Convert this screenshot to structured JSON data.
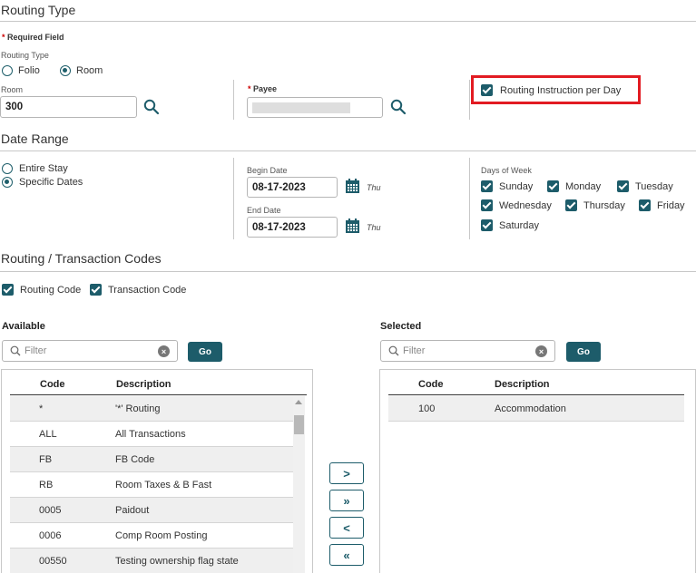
{
  "routing_type": {
    "section_title": "Routing Type",
    "required_note": "Required Field",
    "field_label": "Routing Type",
    "options": [
      {
        "label": "Folio",
        "selected": false
      },
      {
        "label": "Room",
        "selected": true
      }
    ],
    "room_label": "Room",
    "room_value": "300",
    "payee_label": "Payee",
    "payee_value": "",
    "per_day_label": "Routing Instruction per Day",
    "per_day_checked": true
  },
  "date_range": {
    "section_title": "Date Range",
    "options": [
      {
        "label": "Entire Stay",
        "selected": false
      },
      {
        "label": "Specific Dates",
        "selected": true
      }
    ],
    "begin_label": "Begin Date",
    "begin_value": "08-17-2023",
    "begin_day": "Thu",
    "end_label": "End Date",
    "end_value": "08-17-2023",
    "end_day": "Thu",
    "days_label": "Days of Week",
    "days": [
      {
        "label": "Sunday",
        "checked": true
      },
      {
        "label": "Monday",
        "checked": true
      },
      {
        "label": "Tuesday",
        "checked": true
      },
      {
        "label": "Wednesday",
        "checked": true
      },
      {
        "label": "Thursday",
        "checked": true
      },
      {
        "label": "Friday",
        "checked": true
      },
      {
        "label": "Saturday",
        "checked": true
      }
    ]
  },
  "codes": {
    "section_title": "Routing / Transaction Codes",
    "routing_code_label": "Routing Code",
    "transaction_code_label": "Transaction Code",
    "available": {
      "title": "Available",
      "filter_placeholder": "Filter",
      "go_label": "Go",
      "col_code": "Code",
      "col_desc": "Description",
      "rows": [
        {
          "code": "*",
          "desc": "'*' Routing"
        },
        {
          "code": "ALL",
          "desc": "All Transactions"
        },
        {
          "code": "FB",
          "desc": "FB Code"
        },
        {
          "code": "RB",
          "desc": "Room Taxes & B Fast"
        },
        {
          "code": "0005",
          "desc": "Paidout"
        },
        {
          "code": "0006",
          "desc": "Comp Room Posting"
        },
        {
          "code": "00550",
          "desc": "Testing ownership flag state"
        }
      ]
    },
    "selected": {
      "title": "Selected",
      "filter_placeholder": "Filter",
      "go_label": "Go",
      "col_code": "Code",
      "col_desc": "Description",
      "rows": [
        {
          "code": "100",
          "desc": "Accommodation"
        }
      ]
    },
    "move_buttons": [
      ">",
      "»",
      "<",
      "«"
    ]
  },
  "colors": {
    "accent": "#1d5c6a",
    "highlight": "#e21b22"
  }
}
